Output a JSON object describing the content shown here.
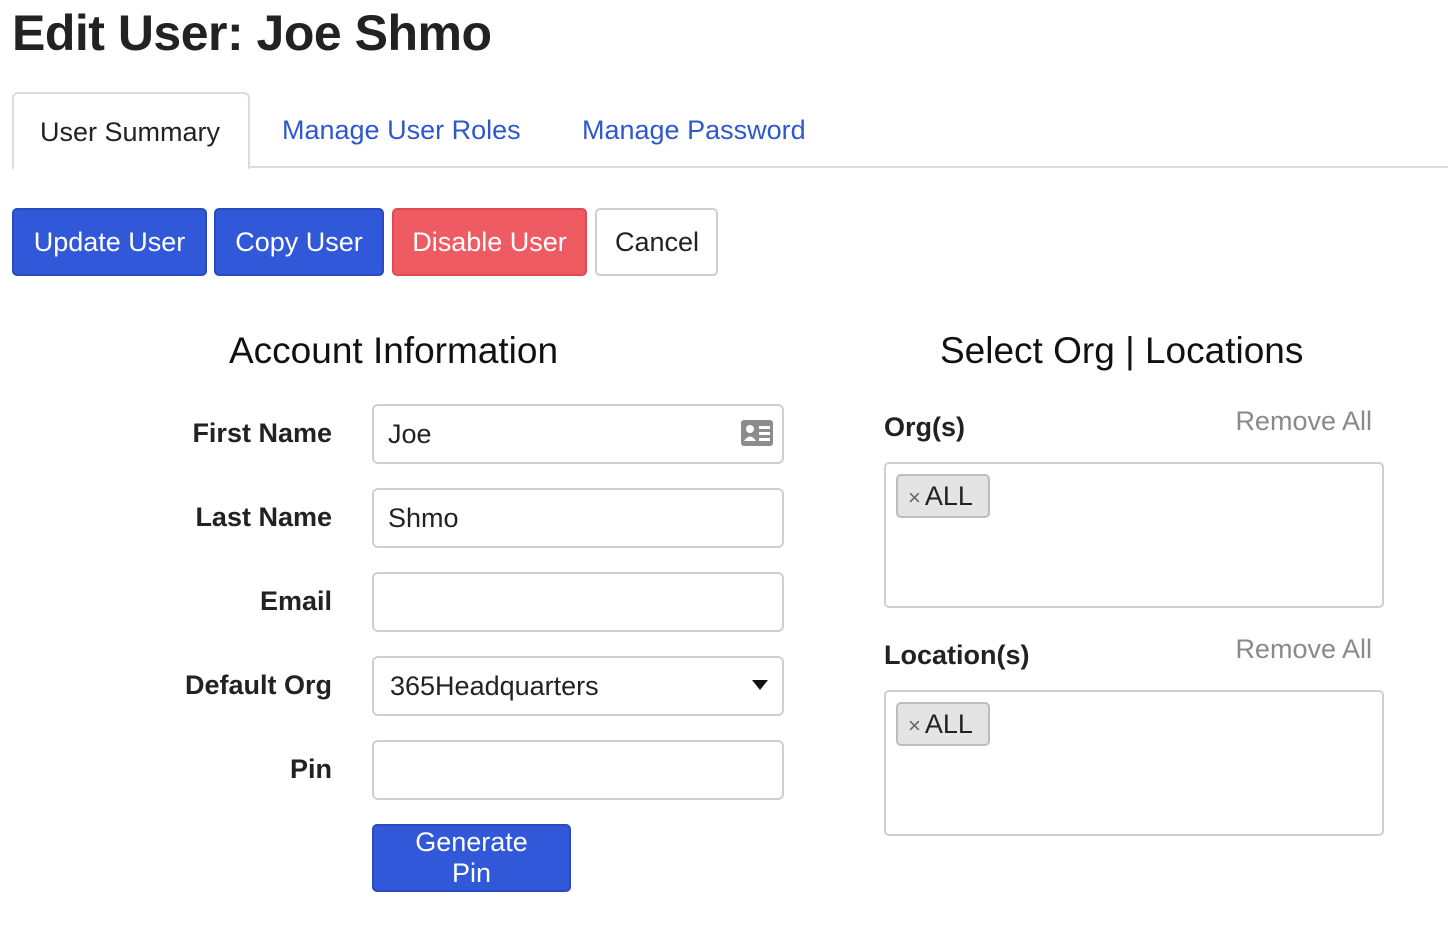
{
  "page": {
    "title": "Edit User: Joe Shmo"
  },
  "tabs": [
    {
      "label": "User Summary",
      "active": true
    },
    {
      "label": "Manage User Roles",
      "active": false
    },
    {
      "label": "Manage Password",
      "active": false
    }
  ],
  "actions": {
    "update": "Update User",
    "copy": "Copy User",
    "disable": "Disable User",
    "cancel": "Cancel"
  },
  "account": {
    "heading": "Account Information",
    "first_name": {
      "label": "First Name",
      "value": "Joe",
      "icon": "contact-card-icon"
    },
    "last_name": {
      "label": "Last Name",
      "value": "Shmo"
    },
    "email": {
      "label": "Email",
      "value": ""
    },
    "default_org": {
      "label": "Default Org",
      "value": "365Headquarters"
    },
    "pin": {
      "label": "Pin",
      "value": ""
    },
    "generate_pin": "Generate Pin"
  },
  "org_locations": {
    "heading": "Select Org | Locations",
    "orgs": {
      "label": "Org(s)",
      "remove_all": "Remove All",
      "chips": [
        "ALL"
      ],
      "remove_symbol": "×"
    },
    "locations": {
      "label": "Location(s)",
      "remove_all": "Remove All",
      "chips": [
        "ALL"
      ],
      "remove_symbol": "×"
    }
  },
  "colors": {
    "primary": "#3158d8",
    "danger": "#ee5b63",
    "link": "#2f58cf",
    "muted": "#8a8a8a"
  }
}
